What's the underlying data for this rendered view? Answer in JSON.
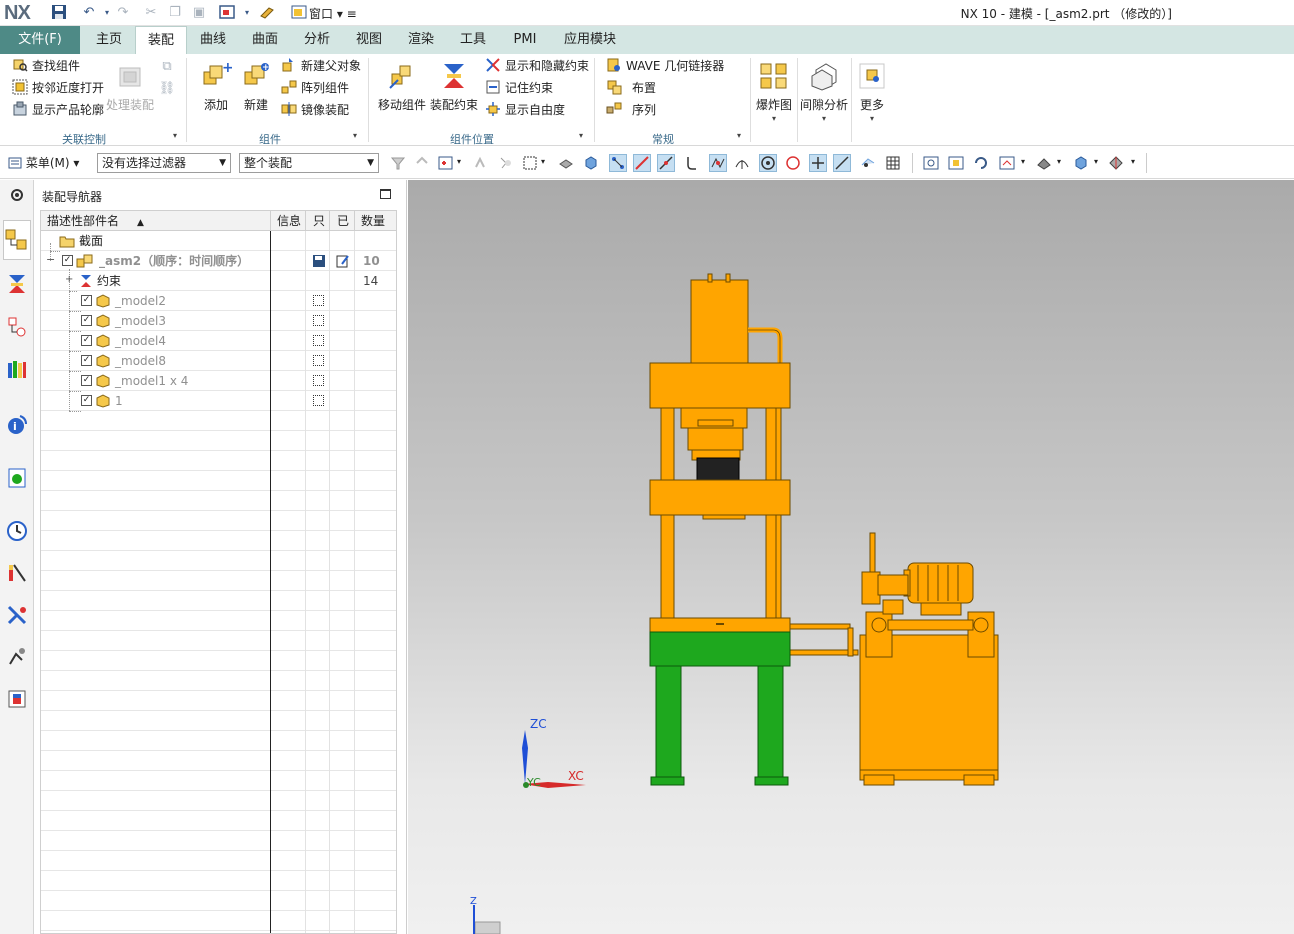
{
  "app": {
    "logo": "NX",
    "title": "NX 10 - 建模 - [_asm2.prt （修改的）]",
    "window_menu_label": "窗口"
  },
  "menubar": {
    "file_label": "文件(F)",
    "tabs": [
      "主页",
      "装配",
      "曲线",
      "曲面",
      "分析",
      "视图",
      "渲染",
      "工具",
      "PMI",
      "应用模块"
    ],
    "active_tab": "装配"
  },
  "ribbon": {
    "group_association": {
      "label": "关联控制",
      "items": [
        "查找组件",
        "按邻近度打开",
        "显示产品轮廓"
      ],
      "disabled_big": "处理装配"
    },
    "group_component": {
      "label": "组件",
      "big_add": "添加",
      "big_new": "新建",
      "items": [
        "新建父对象",
        "阵列组件",
        "镜像装配"
      ]
    },
    "group_position": {
      "label": "组件位置",
      "big_move": "移动组件",
      "big_constraint": "装配约束",
      "items": [
        "显示和隐藏约束",
        "记住约束",
        "显示自由度"
      ]
    },
    "group_general": {
      "label": "常规",
      "items": [
        "WAVE 几何链接器",
        "布置",
        "序列"
      ]
    },
    "big_exploded": "爆炸图",
    "big_clearance": "间隙分析",
    "big_more": "更多"
  },
  "toolbar": {
    "menu_label": "菜单(M)",
    "filter_value": "没有选择过滤器",
    "scope_value": "整个装配"
  },
  "navigator": {
    "title": "装配导航器",
    "columns": {
      "name": "描述性部件名",
      "info": "信息",
      "readonly": "只",
      "modified": "已",
      "quantity": "数量"
    },
    "rows": [
      {
        "name": "截面",
        "quantity": ""
      },
      {
        "name": "_asm2（顺序：时间顺序）",
        "quantity": "10"
      },
      {
        "name": "约束",
        "quantity": "14"
      },
      {
        "name": "_model2",
        "quantity": ""
      },
      {
        "name": "_model3",
        "quantity": ""
      },
      {
        "name": "_model4",
        "quantity": ""
      },
      {
        "name": "_model8",
        "quantity": ""
      },
      {
        "name": "_model1 x 4",
        "quantity": ""
      },
      {
        "name": "1",
        "quantity": ""
      }
    ]
  },
  "viewport": {
    "triad": {
      "z": "ZC",
      "y": "YC",
      "x": "XC"
    },
    "mini_triad_z": "Z"
  },
  "colors": {
    "press_orange": "#ffa500",
    "press_green": "#1ea81e",
    "file_tab": "#4e8a86",
    "menubar_bg": "#d4e6e3"
  }
}
